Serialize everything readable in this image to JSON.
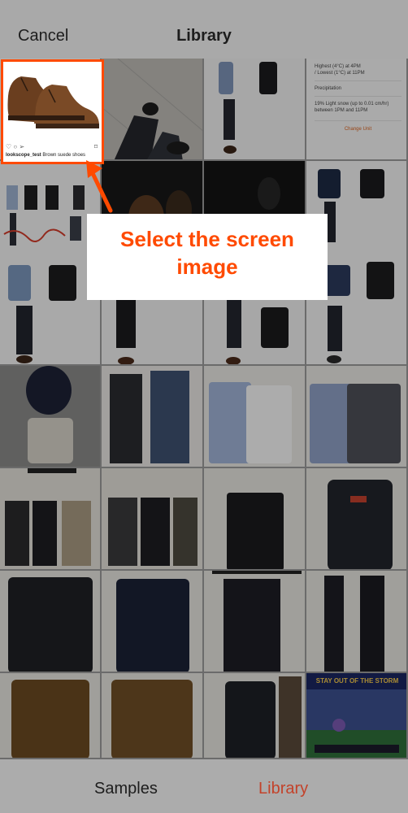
{
  "header": {
    "cancel_label": "Cancel",
    "title": "Library"
  },
  "selected_thumb": {
    "account": "lookscope_test",
    "caption": "Brown suede shoes"
  },
  "weather_thumb": {
    "line1": "Highest (4°C) at 4PM",
    "line2": "/ Lowest (1°C) at 11PM",
    "line3": "Precipitation",
    "line4": "19%  Light snow (up to 0.01 cm/hr)",
    "line5": "between 1PM and 11PM",
    "link": "Change Unit"
  },
  "game_thumb": {
    "caption": "STAY OUT OF THE STORM"
  },
  "callout": {
    "line1": "Select the screen",
    "line2": "image"
  },
  "tabs": {
    "samples": "Samples",
    "library": "Library"
  },
  "colors": {
    "accent": "#ff4a00",
    "active_tab": "#c3422a",
    "overlay": "#a8a8a8"
  }
}
